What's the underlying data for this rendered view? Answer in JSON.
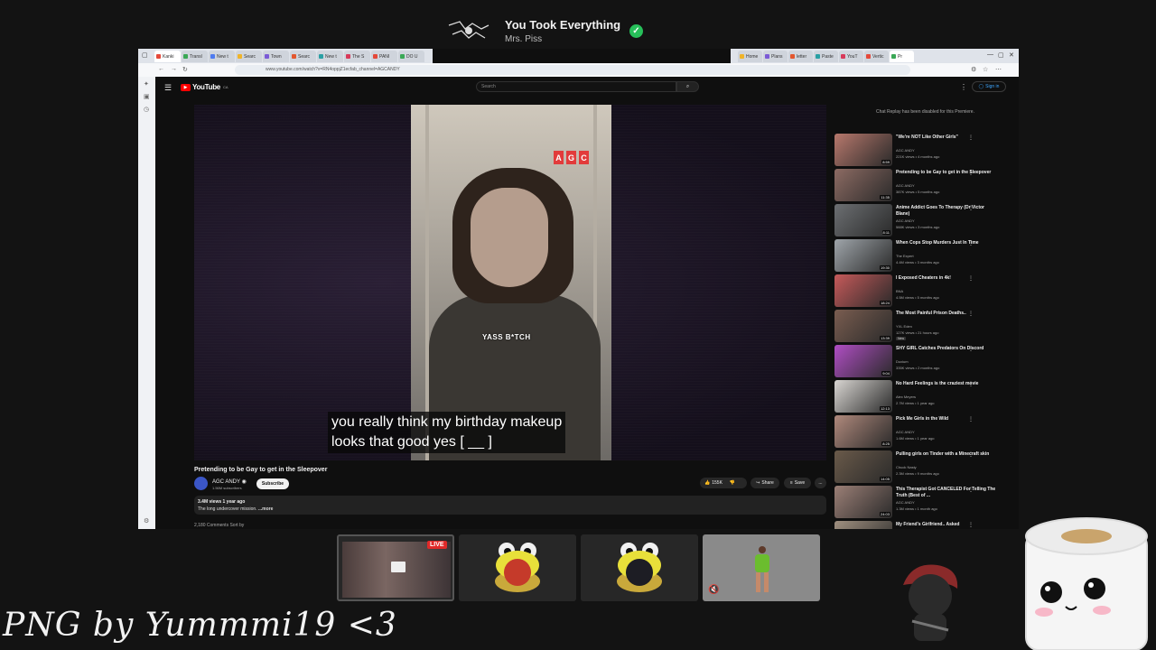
{
  "now_playing": {
    "title": "You Took Everything",
    "artist": "Mrs. Piss",
    "art_icon": "album-art-icon",
    "status_icon": "check-icon"
  },
  "browser": {
    "tabs_left": [
      "Kanki",
      "Transl",
      "New t",
      "Searc",
      "Town",
      "Searc",
      "New t",
      "The S",
      "PANI",
      "DO U"
    ],
    "tabs_right": [
      "Home",
      "Plans",
      "letter",
      "Paste",
      "YouT",
      "Vertic",
      "Pr"
    ],
    "url": "www.youtube.com/watch?v=RN4oppjZ1ecfab_channel=AGCANDY"
  },
  "youtube": {
    "logo_text": "YouTube",
    "logo_sup": "CA",
    "search_placeholder": "Search",
    "signin_label": "Sign in",
    "video": {
      "brand_letters": [
        "A",
        "G",
        "C"
      ],
      "overlay_text": "YASS B*TCH",
      "caption": "you really think my birthday makeup\nlooks that good yes [ __ ]"
    },
    "title": "Pretending to be Gay to get in the Sleepover",
    "channel": {
      "name": "AGC ANDY",
      "subs": "1.56M subscribers",
      "subscribe_label": "Subscribe"
    },
    "actions": {
      "likes": "155K",
      "share": "Share",
      "save": "Save",
      "more": "..."
    },
    "description": {
      "meta": "3.4M views  1 year ago",
      "text": "The long undercover mission.",
      "more": "...more"
    },
    "comments_peek": "2,180 Comments    Sort by",
    "chat_note": "Chat Replay has been disabled for this Premiere.",
    "recommendations": [
      {
        "title": "\"We're NOT Like Other Girls\"",
        "channel": "AGC ANDY",
        "views": "221K views • 4 months ago",
        "duration": "8:59",
        "color": "#b7786c"
      },
      {
        "title": "Pretending to be Gay to get in the Sleepover",
        "channel": "AGC ANDY",
        "views": "387K views • 5 months ago",
        "duration": "11:35",
        "color": "#8d6b63"
      },
      {
        "title": "Anime Addict Goes To Therapy (Dr Victor Blane)",
        "channel": "AGC ANDY",
        "views": "588K views • 3 months ago",
        "duration": "8:11",
        "color": "#6c6f72"
      },
      {
        "title": "When Cops Stop Murders Just In Time",
        "channel": "The Expert",
        "views": "4.4M views • 3 months ago",
        "duration": "19:30",
        "color": "#9fa5aa"
      },
      {
        "title": "I Exposed Cheaters in 4k!",
        "channel": "BNA",
        "views": "4.5M views • 5 months ago",
        "duration": "18:24",
        "color": "#c65a5a"
      },
      {
        "title": "The Most Painful Prison Deaths..",
        "channel": "YXL Eden",
        "views": "127K views • 21 hours ago",
        "duration": "13:39",
        "badge": "New",
        "color": "#7a5d50"
      },
      {
        "title": "SHY GIRL Catches Predators On Discord",
        "channel": "Duxium",
        "views": "335K views • 2 months ago",
        "duration": "9:04",
        "color": "#b04ec4"
      },
      {
        "title": "No Hard Feelings is the craziest movie",
        "channel": "Alex Meyers",
        "views": "2.7M views • 1 year ago",
        "duration": "12:13",
        "color": "#d9d6d2"
      },
      {
        "title": "Pick Me Girls in the Wild",
        "channel": "AGC ANDY",
        "views": "1.6M views • 1 year ago",
        "duration": "8:25",
        "color": "#b0897c"
      },
      {
        "title": "Pulling girls on Tinder with a Minecraft skin",
        "channel": "Chuck Nasty",
        "views": "2.3M views • 9 months ago",
        "duration": "14:05",
        "color": "#6a5a4a"
      },
      {
        "title": "This Therapist Got CANCELED For Telling The Truth (Best of ...",
        "channel": "AGC ANDY",
        "views": "1.3M views • 1 month ago",
        "duration": "24:03",
        "color": "#9b7f76"
      },
      {
        "title": "My Friend's Girlfriend.. Asked",
        "channel": "",
        "views": "",
        "duration": "",
        "color": "#a09080"
      }
    ]
  },
  "tiles": {
    "live_badge": "LIVE"
  },
  "signature": "PNG by Yummmi19 <3"
}
